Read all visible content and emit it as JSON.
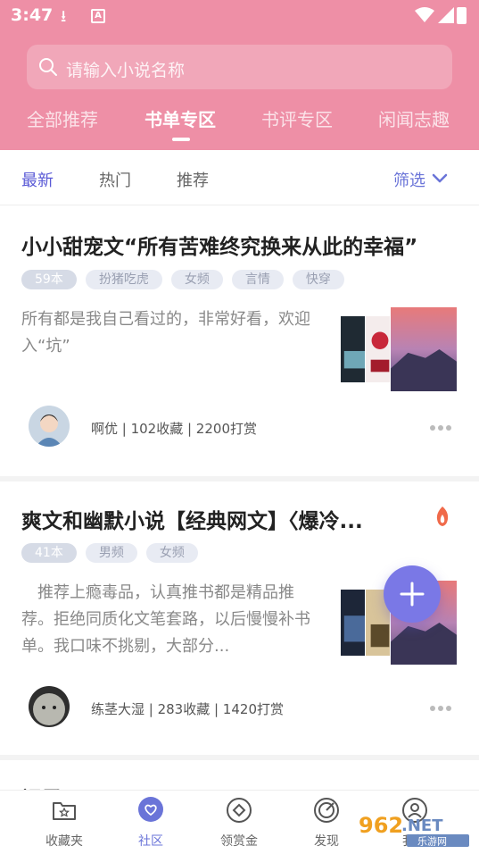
{
  "statusbar": {
    "time": "3:47"
  },
  "search": {
    "placeholder": "请输入小说名称"
  },
  "tabs": [
    {
      "label": "全部推荐"
    },
    {
      "label": "书单专区"
    },
    {
      "label": "书评专区"
    },
    {
      "label": "闲闻志趣"
    }
  ],
  "filters": {
    "items": [
      {
        "label": "最新"
      },
      {
        "label": "热门"
      },
      {
        "label": "推荐"
      }
    ],
    "select_label": "筛选"
  },
  "cards": [
    {
      "title": "小小甜宠文“所有苦难终究换来从此的幸福”",
      "tags": [
        "59本",
        "扮猪吃虎",
        "女频",
        "言情",
        "快穿"
      ],
      "description": "所有都是我自己看过的，非常好看，欢迎入“坑”",
      "meta": "啊优 | 102收藏 | 2200打赏"
    },
    {
      "title": "爽文和幽默小说【经典网文】〈爆冷...",
      "tags": [
        "41本",
        "男频",
        "女频"
      ],
      "description": "推荐上瘾毒品，认真推书都是精品推荐。拒绝同质化文笔套路，以后慢慢补书单。我口味不挑剔，大部分...",
      "meta": "练茎大湿 | 283收藏 | 1420打赏"
    },
    {
      "title": "记录"
    }
  ],
  "bottomnav": [
    {
      "label": "收藏夹",
      "icon": "folder-star-icon"
    },
    {
      "label": "社区",
      "icon": "chat-heart-icon"
    },
    {
      "label": "领赏金",
      "icon": "diamond-icon"
    },
    {
      "label": "发现",
      "icon": "compass-icon"
    },
    {
      "label": "我的",
      "icon": "person-icon"
    }
  ],
  "watermark": {
    "text": "962.NET",
    "subtext": "乐游网"
  },
  "colors": {
    "header": "#ee8fa6",
    "accent": "#6a74d8",
    "fab": "#7a78e6"
  }
}
